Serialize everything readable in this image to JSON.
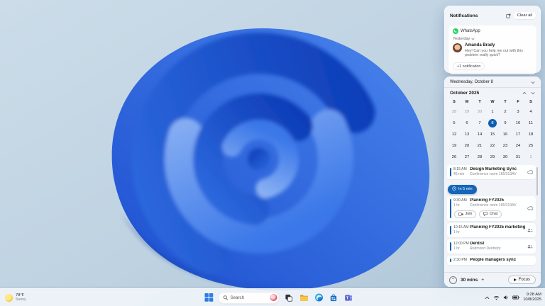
{
  "notifications": {
    "title": "Notifications",
    "clear_all": "Clear all",
    "app_name": "WhatsApp",
    "group_label": "Yesterday",
    "sender": "Amanda Brady",
    "message": "Hey! Can you help me out with this problem really quick?",
    "more": "+1 notification"
  },
  "calendar": {
    "date_header": "Wednesday, October 8",
    "month_label": "October 2025",
    "weekdays": [
      "S",
      "M",
      "T",
      "W",
      "T",
      "F",
      "S"
    ],
    "weeks": [
      [
        28,
        29,
        30,
        1,
        2,
        3,
        4
      ],
      [
        5,
        6,
        7,
        8,
        9,
        10,
        11
      ],
      [
        12,
        13,
        14,
        15,
        16,
        17,
        18
      ],
      [
        19,
        20,
        21,
        22,
        23,
        24,
        25
      ],
      [
        26,
        27,
        28,
        29,
        30,
        31,
        1
      ]
    ],
    "selected_day": 8,
    "reminder": "In 5 min",
    "events": [
      {
        "time": "8:15 AM",
        "duration": "45 min",
        "title": "Design Marketing Sync",
        "location": "Conference room 165/313AV",
        "icon": "cloud-icon",
        "actions": []
      },
      {
        "time": "9:30 AM",
        "duration": "1 hr",
        "title": "Planning FY2025",
        "location": "Conference room 165/313AV",
        "icon": "cloud-icon",
        "actions": [
          "Join",
          "Chat"
        ]
      },
      {
        "time": "10:15 AM",
        "duration": "1 hr",
        "title": "Planning FY2025 marketing",
        "location": "",
        "icon": "people-icon",
        "actions": []
      },
      {
        "time": "12:00 PM",
        "duration": "1 hr",
        "title": "Dentist",
        "location": "Redmond Dentistry",
        "icon": "people-icon",
        "actions": []
      },
      {
        "time": "2:30 PM",
        "duration": "",
        "title": "People managers sync",
        "location": "",
        "icon": "",
        "actions": []
      }
    ],
    "footer": {
      "duration": "30 mins",
      "focus": "Focus"
    }
  },
  "taskbar": {
    "weather": {
      "temp": "78°F",
      "condition": "Sunny"
    },
    "search": "Search",
    "pinned": [
      "start",
      "search",
      "task-view",
      "file-explorer",
      "edge",
      "store",
      "teams"
    ],
    "tray_icons": [
      "chevron-up",
      "wifi",
      "volume",
      "battery"
    ],
    "tray": {
      "time": "9:28 AM",
      "date": "10/8/2025"
    }
  },
  "colors": {
    "accent": "#0B5FB0",
    "reminder_pill": "#1466B8",
    "whatsapp_green": "#25D366",
    "wallpaper_sky": "#C2D4E2",
    "bloom_blue": "#2057D6"
  }
}
